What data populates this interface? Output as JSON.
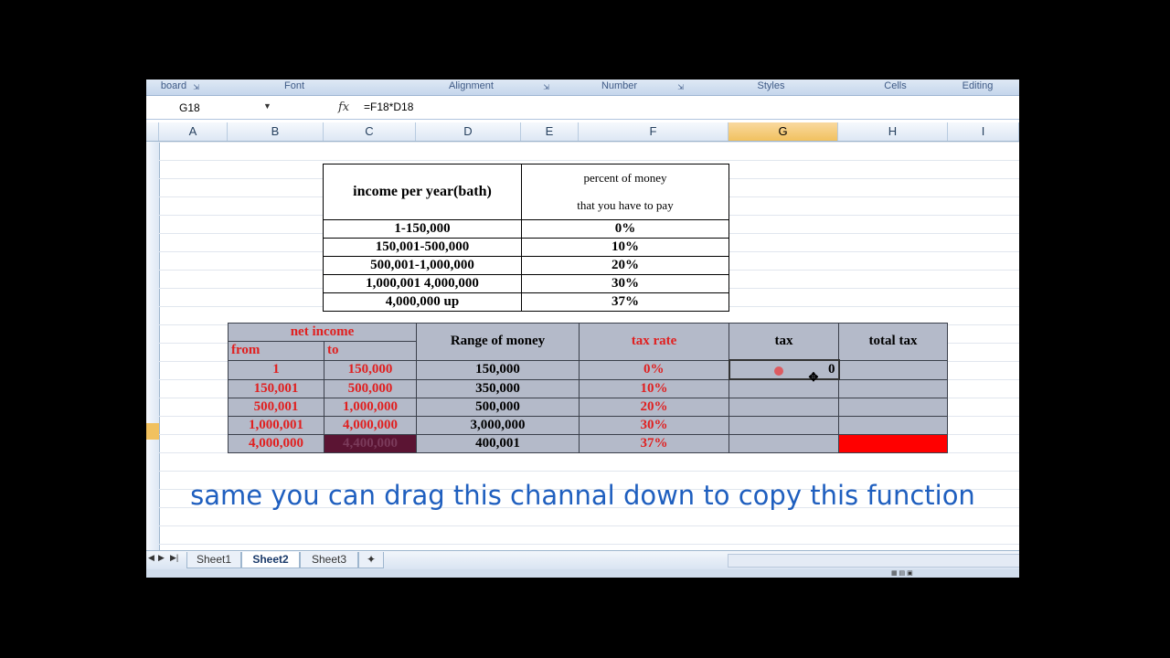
{
  "ribbon": {
    "groups": [
      {
        "label": "board"
      },
      {
        "label": "Font"
      },
      {
        "label": "Alignment"
      },
      {
        "label": "Number"
      },
      {
        "label": "Styles"
      },
      {
        "label": "Cells"
      },
      {
        "label": "Editing"
      }
    ]
  },
  "formula_bar": {
    "name_box": "G18",
    "fx_icon": "function-icon",
    "formula": "=F18*D18"
  },
  "columns": [
    "A",
    "B",
    "C",
    "D",
    "E",
    "F",
    "G",
    "H",
    "I"
  ],
  "selected_column": "G",
  "rate_table": {
    "header_income": "income per year(bath)",
    "header_percent_line1": "percent of money",
    "header_percent_line2": "that you have to pay",
    "rows": [
      {
        "range": "1-150,000",
        "rate": "0%"
      },
      {
        "range": "150,001-500,000",
        "rate": "10%"
      },
      {
        "range": "500,001-1,000,000",
        "rate": "20%"
      },
      {
        "range": "1,000,001 4,000,000",
        "rate": "30%"
      },
      {
        "range": "4,000,000 up",
        "rate": "37%"
      }
    ]
  },
  "tax_table": {
    "net_income": "net income",
    "from": "from",
    "to": "to",
    "range_of_money": "Range of money",
    "tax_rate": "tax rate",
    "tax": "tax",
    "total_tax": "total tax",
    "rows": [
      {
        "from": "1",
        "to": "150,000",
        "range": "150,000",
        "rate": "0%",
        "tax": "0"
      },
      {
        "from": "150,001",
        "to": "500,000",
        "range": "350,000",
        "rate": "10%",
        "tax": ""
      },
      {
        "from": "500,001",
        "to": "1,000,000",
        "range": "500,000",
        "rate": "20%",
        "tax": ""
      },
      {
        "from": "1,000,001",
        "to": "4,000,000",
        "range": "3,000,000",
        "rate": "30%",
        "tax": ""
      },
      {
        "from": "4,000,000",
        "to": "4,400,000",
        "range": "400,001",
        "rate": "37%",
        "tax": ""
      }
    ]
  },
  "caption": "same you can drag this channal down to copy this function",
  "sheets": [
    {
      "label": "Sheet1"
    },
    {
      "label": "Sheet2"
    },
    {
      "label": "Sheet3"
    }
  ],
  "active_sheet": "Sheet2",
  "colors": {
    "caption": "#1f5fbf",
    "red_text": "#e02020",
    "table_fill": "#b4bac9",
    "red_fill": "#ff0000"
  }
}
